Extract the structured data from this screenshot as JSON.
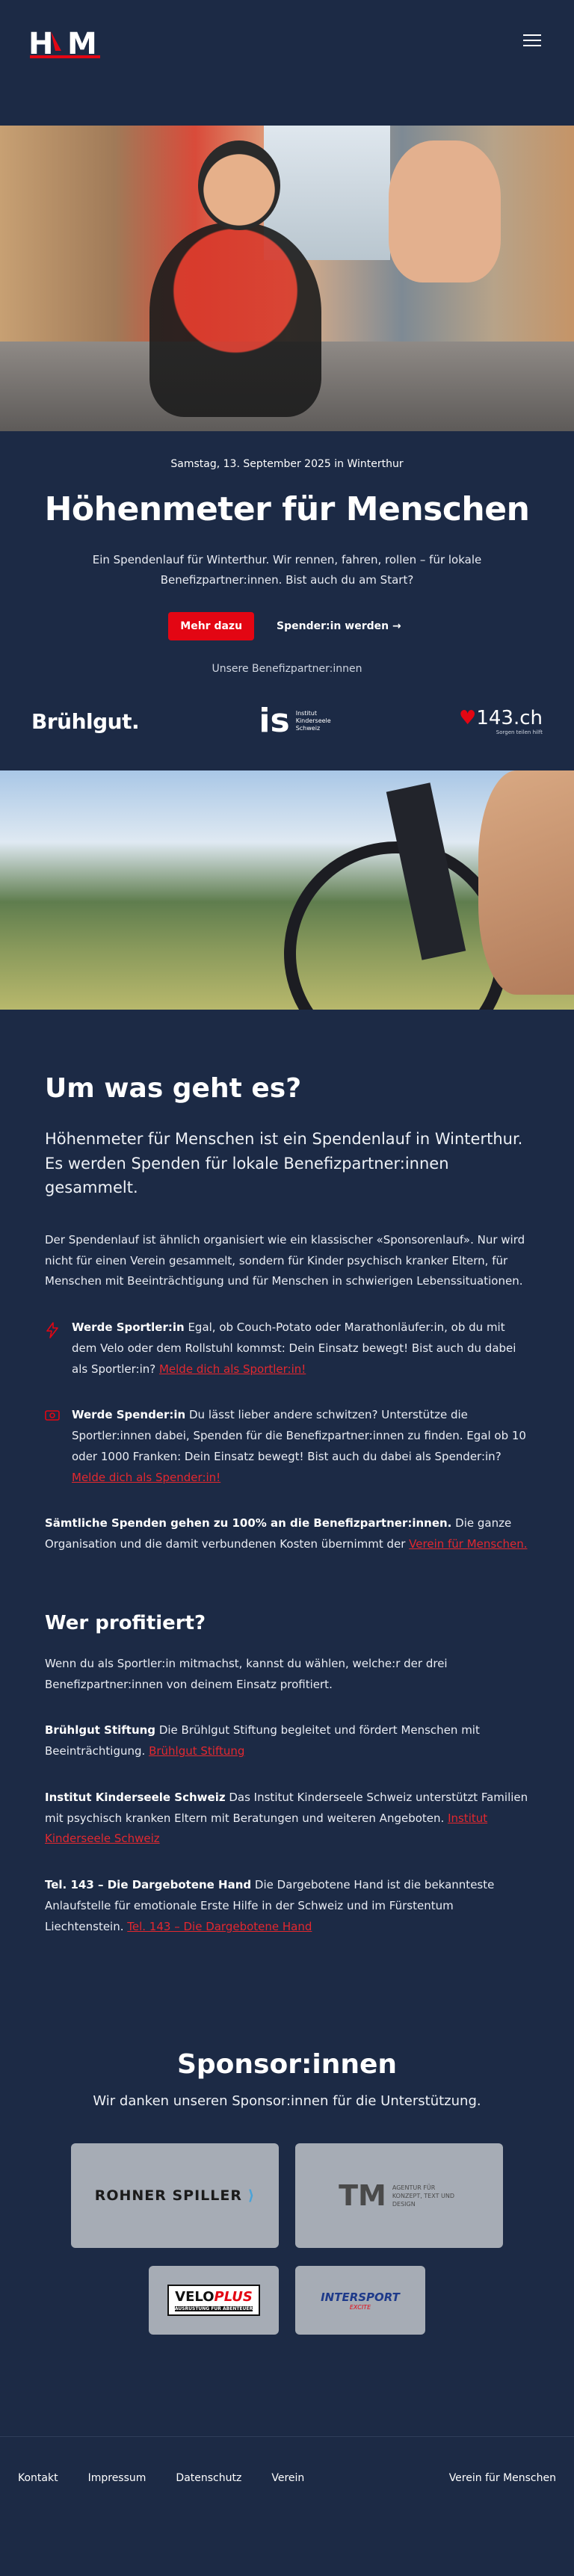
{
  "header": {
    "logo_text": "HfM",
    "menu_icon": "hamburger-icon"
  },
  "hero": {
    "date": "Samstag, 13. September 2025 in Winterthur",
    "title": "Höhenmeter für Menschen",
    "lead": "Ein Spendenlauf für Winterthur. Wir rennen, fahren, rollen – für lokale Benefizpartner:innen. Bist auch du am Start?",
    "primary_button": "Mehr dazu",
    "secondary_button": "Spender:in werden →",
    "partners_heading": "Unsere Benefizpartner:innen",
    "partners": {
      "bruehlgut": "Brühlgut.",
      "kinderseele_mark": "is",
      "kinderseele_text": "Institut Kinderseele Schweiz",
      "dargebotene_mark": "143.ch",
      "dargebotene_sub": "Sorgen teilen hilft"
    }
  },
  "about": {
    "title": "Um was geht es?",
    "lead": "Höhenmeter für Menschen ist ein Spendenlauf in Winterthur. Es werden Spenden für lokale Benefizpartner:innen gesammelt.",
    "paragraph": "Der Spendenlauf ist ähnlich organisiert wie ein klassischer «Sponsorenlauf». Nur wird nicht für einen Verein gesammelt, sondern für Kinder psychisch kranker Eltern, für Menschen mit Beeinträchtigung und für Menschen in schwierigen Lebenssituationen.",
    "features": [
      {
        "strong": "Werde Sportler:in",
        "text": " Egal, ob Couch-Potato oder Marathonläufer:in, ob du mit dem Velo oder dem Rollstuhl kommst: Dein Einsatz bewegt! Bist auch du dabei als Sportler:in? ",
        "link": "Melde dich als Sportler:in!"
      },
      {
        "strong": "Werde Spender:in",
        "text": " Du lässt lieber andere schwitzen? Unterstütze die Sportler:innen dabei, Spenden für die Benefizpartner:innen zu finden. Egal ob 10 oder 1000 Franken: Dein Einsatz bewegt! Bist auch du dabei als Spender:in? ",
        "link": "Melde dich als Spender:in!"
      }
    ],
    "all_strong": "Sämtliche Spenden gehen zu 100% an die Benefizpartner:innen.",
    "all_text": " Die ganze Organisation und die damit verbundenen Kosten übernimmt der ",
    "all_link": "Verein für Menschen."
  },
  "beneficiaries": {
    "title": "Wer profitiert?",
    "intro": "Wenn du als Sportler:in mitmachst, kannst du wählen, welche:r der drei Benefizpartner:innen von deinem Einsatz profitiert.",
    "items": [
      {
        "strong": "Brühlgut Stiftung",
        "text": " Die Brühlgut Stiftung begleitet und fördert Menschen mit Beeinträchtigung. ",
        "link": "Brühlgut Stiftung"
      },
      {
        "strong": "Institut Kinderseele Schweiz",
        "text": " Das Institut Kinderseele Schweiz unterstützt Familien mit psychisch kranken Eltern mit Beratungen und weiteren Angeboten. ",
        "link": "Institut Kinderseele Schweiz"
      },
      {
        "strong": "Tel. 143 – Die Dargebotene Hand",
        "text": " Die Dargebotene Hand ist die bekannteste Anlaufstelle für emotionale Erste Hilfe in der Schweiz und im Fürstentum Liechtenstein. ",
        "link": "Tel. 143 – Die Dargebotene Hand"
      }
    ]
  },
  "sponsors": {
    "title": "Sponsor:innen",
    "thanks": "Wir danken unseren Sponsor:innen für die Unterstützung.",
    "logos": {
      "rohner": "ROHNER SPILLER",
      "tm_mark": "TM",
      "tm_text": "AGENTUR FÜR KONZEPT, TEXT UND DESIGN",
      "veloplus_a": "VELO",
      "veloplus_b": "PLUS",
      "veloplus_sub": "AUSRÜSTUNG FÜR ABENTEUER",
      "intersport": "INTERSPORT",
      "intersport_sub": "EXCITE"
    }
  },
  "footer": {
    "links": [
      "Kontakt",
      "Impressum",
      "Datenschutz",
      "Verein"
    ],
    "right": "Verein für Menschen"
  }
}
